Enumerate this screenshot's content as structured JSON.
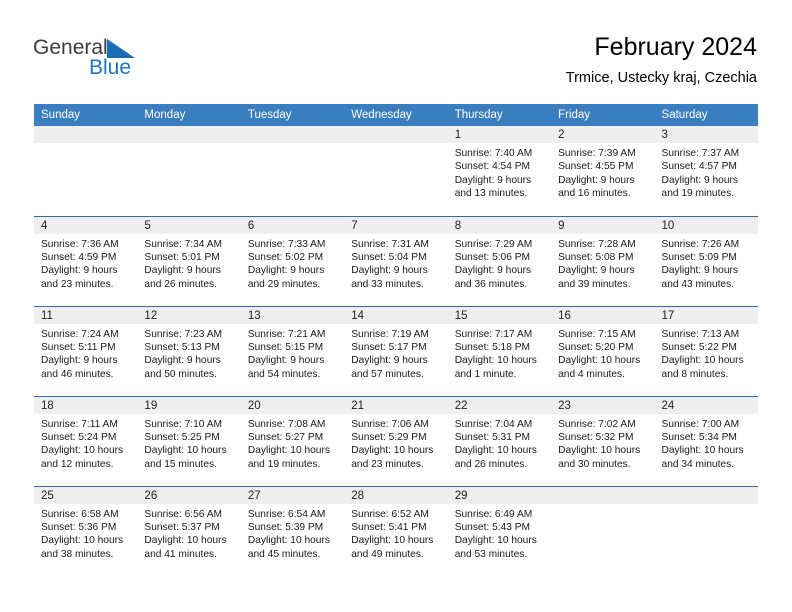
{
  "brand": {
    "name_part1": "General",
    "name_part2": "Blue"
  },
  "header": {
    "title": "February 2024",
    "subtitle": "Trmice, Ustecky kraj, Czechia"
  },
  "colors": {
    "header_blue": "#3a7ebf",
    "row_divider": "#2f6ba8",
    "day_band": "#efefef",
    "brand_blue": "#1a75bb"
  },
  "weekday_headers": [
    "Sunday",
    "Monday",
    "Tuesday",
    "Wednesday",
    "Thursday",
    "Friday",
    "Saturday"
  ],
  "weeks": [
    [
      {
        "day": "",
        "empty": true,
        "sunrise": "",
        "sunset": "",
        "daylight1": "",
        "daylight2": ""
      },
      {
        "day": "",
        "empty": true,
        "sunrise": "",
        "sunset": "",
        "daylight1": "",
        "daylight2": ""
      },
      {
        "day": "",
        "empty": true,
        "sunrise": "",
        "sunset": "",
        "daylight1": "",
        "daylight2": ""
      },
      {
        "day": "",
        "empty": true,
        "sunrise": "",
        "sunset": "",
        "daylight1": "",
        "daylight2": ""
      },
      {
        "day": "1",
        "sunrise": "Sunrise: 7:40 AM",
        "sunset": "Sunset: 4:54 PM",
        "daylight1": "Daylight: 9 hours",
        "daylight2": "and 13 minutes."
      },
      {
        "day": "2",
        "sunrise": "Sunrise: 7:39 AM",
        "sunset": "Sunset: 4:55 PM",
        "daylight1": "Daylight: 9 hours",
        "daylight2": "and 16 minutes."
      },
      {
        "day": "3",
        "sunrise": "Sunrise: 7:37 AM",
        "sunset": "Sunset: 4:57 PM",
        "daylight1": "Daylight: 9 hours",
        "daylight2": "and 19 minutes."
      }
    ],
    [
      {
        "day": "4",
        "sunrise": "Sunrise: 7:36 AM",
        "sunset": "Sunset: 4:59 PM",
        "daylight1": "Daylight: 9 hours",
        "daylight2": "and 23 minutes."
      },
      {
        "day": "5",
        "sunrise": "Sunrise: 7:34 AM",
        "sunset": "Sunset: 5:01 PM",
        "daylight1": "Daylight: 9 hours",
        "daylight2": "and 26 minutes."
      },
      {
        "day": "6",
        "sunrise": "Sunrise: 7:33 AM",
        "sunset": "Sunset: 5:02 PM",
        "daylight1": "Daylight: 9 hours",
        "daylight2": "and 29 minutes."
      },
      {
        "day": "7",
        "sunrise": "Sunrise: 7:31 AM",
        "sunset": "Sunset: 5:04 PM",
        "daylight1": "Daylight: 9 hours",
        "daylight2": "and 33 minutes."
      },
      {
        "day": "8",
        "sunrise": "Sunrise: 7:29 AM",
        "sunset": "Sunset: 5:06 PM",
        "daylight1": "Daylight: 9 hours",
        "daylight2": "and 36 minutes."
      },
      {
        "day": "9",
        "sunrise": "Sunrise: 7:28 AM",
        "sunset": "Sunset: 5:08 PM",
        "daylight1": "Daylight: 9 hours",
        "daylight2": "and 39 minutes."
      },
      {
        "day": "10",
        "sunrise": "Sunrise: 7:26 AM",
        "sunset": "Sunset: 5:09 PM",
        "daylight1": "Daylight: 9 hours",
        "daylight2": "and 43 minutes."
      }
    ],
    [
      {
        "day": "11",
        "sunrise": "Sunrise: 7:24 AM",
        "sunset": "Sunset: 5:11 PM",
        "daylight1": "Daylight: 9 hours",
        "daylight2": "and 46 minutes."
      },
      {
        "day": "12",
        "sunrise": "Sunrise: 7:23 AM",
        "sunset": "Sunset: 5:13 PM",
        "daylight1": "Daylight: 9 hours",
        "daylight2": "and 50 minutes."
      },
      {
        "day": "13",
        "sunrise": "Sunrise: 7:21 AM",
        "sunset": "Sunset: 5:15 PM",
        "daylight1": "Daylight: 9 hours",
        "daylight2": "and 54 minutes."
      },
      {
        "day": "14",
        "sunrise": "Sunrise: 7:19 AM",
        "sunset": "Sunset: 5:17 PM",
        "daylight1": "Daylight: 9 hours",
        "daylight2": "and 57 minutes."
      },
      {
        "day": "15",
        "sunrise": "Sunrise: 7:17 AM",
        "sunset": "Sunset: 5:18 PM",
        "daylight1": "Daylight: 10 hours",
        "daylight2": "and 1 minute."
      },
      {
        "day": "16",
        "sunrise": "Sunrise: 7:15 AM",
        "sunset": "Sunset: 5:20 PM",
        "daylight1": "Daylight: 10 hours",
        "daylight2": "and 4 minutes."
      },
      {
        "day": "17",
        "sunrise": "Sunrise: 7:13 AM",
        "sunset": "Sunset: 5:22 PM",
        "daylight1": "Daylight: 10 hours",
        "daylight2": "and 8 minutes."
      }
    ],
    [
      {
        "day": "18",
        "sunrise": "Sunrise: 7:11 AM",
        "sunset": "Sunset: 5:24 PM",
        "daylight1": "Daylight: 10 hours",
        "daylight2": "and 12 minutes."
      },
      {
        "day": "19",
        "sunrise": "Sunrise: 7:10 AM",
        "sunset": "Sunset: 5:25 PM",
        "daylight1": "Daylight: 10 hours",
        "daylight2": "and 15 minutes."
      },
      {
        "day": "20",
        "sunrise": "Sunrise: 7:08 AM",
        "sunset": "Sunset: 5:27 PM",
        "daylight1": "Daylight: 10 hours",
        "daylight2": "and 19 minutes."
      },
      {
        "day": "21",
        "sunrise": "Sunrise: 7:06 AM",
        "sunset": "Sunset: 5:29 PM",
        "daylight1": "Daylight: 10 hours",
        "daylight2": "and 23 minutes."
      },
      {
        "day": "22",
        "sunrise": "Sunrise: 7:04 AM",
        "sunset": "Sunset: 5:31 PM",
        "daylight1": "Daylight: 10 hours",
        "daylight2": "and 26 minutes."
      },
      {
        "day": "23",
        "sunrise": "Sunrise: 7:02 AM",
        "sunset": "Sunset: 5:32 PM",
        "daylight1": "Daylight: 10 hours",
        "daylight2": "and 30 minutes."
      },
      {
        "day": "24",
        "sunrise": "Sunrise: 7:00 AM",
        "sunset": "Sunset: 5:34 PM",
        "daylight1": "Daylight: 10 hours",
        "daylight2": "and 34 minutes."
      }
    ],
    [
      {
        "day": "25",
        "sunrise": "Sunrise: 6:58 AM",
        "sunset": "Sunset: 5:36 PM",
        "daylight1": "Daylight: 10 hours",
        "daylight2": "and 38 minutes."
      },
      {
        "day": "26",
        "sunrise": "Sunrise: 6:56 AM",
        "sunset": "Sunset: 5:37 PM",
        "daylight1": "Daylight: 10 hours",
        "daylight2": "and 41 minutes."
      },
      {
        "day": "27",
        "sunrise": "Sunrise: 6:54 AM",
        "sunset": "Sunset: 5:39 PM",
        "daylight1": "Daylight: 10 hours",
        "daylight2": "and 45 minutes."
      },
      {
        "day": "28",
        "sunrise": "Sunrise: 6:52 AM",
        "sunset": "Sunset: 5:41 PM",
        "daylight1": "Daylight: 10 hours",
        "daylight2": "and 49 minutes."
      },
      {
        "day": "29",
        "sunrise": "Sunrise: 6:49 AM",
        "sunset": "Sunset: 5:43 PM",
        "daylight1": "Daylight: 10 hours",
        "daylight2": "and 53 minutes."
      },
      {
        "day": "",
        "empty": true,
        "sunrise": "",
        "sunset": "",
        "daylight1": "",
        "daylight2": ""
      },
      {
        "day": "",
        "empty": true,
        "sunrise": "",
        "sunset": "",
        "daylight1": "",
        "daylight2": ""
      }
    ]
  ]
}
